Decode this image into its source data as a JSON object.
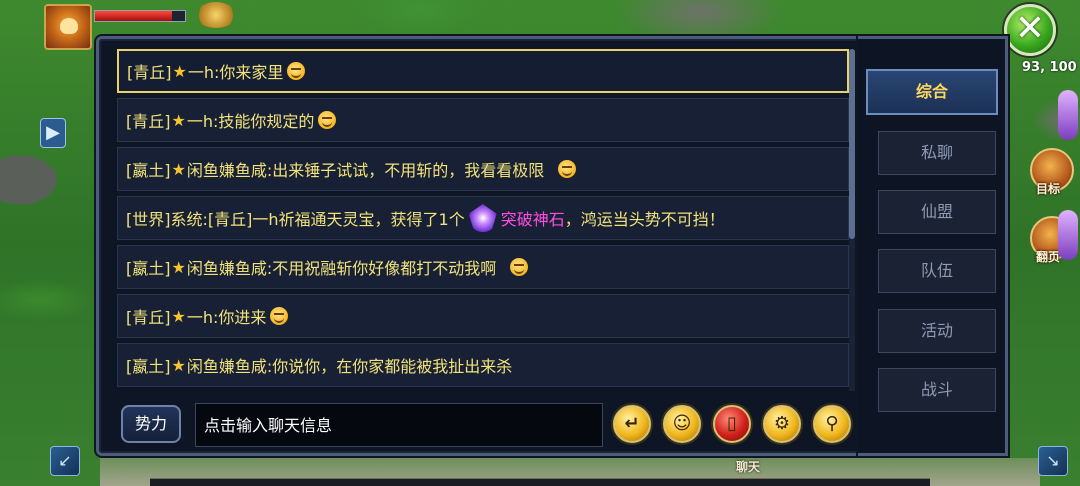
{
  "hud": {
    "hp_fraction": 0.85,
    "coordinates_text": "93, 100",
    "target_label": "目标",
    "flip_label": "翻页",
    "scene_label": "聊天"
  },
  "chat": {
    "messages": [
      {
        "channel": "[青丘]",
        "star": "★",
        "sender": "一h",
        "text": ":你来家里",
        "emoji": true,
        "selected": true
      },
      {
        "channel": "[青丘]",
        "star": "★",
        "sender": "一h",
        "text": ":技能你规定的",
        "emoji": true,
        "selected": false
      },
      {
        "channel": "[嬴土]",
        "star": "★",
        "sender": "闲鱼嫌鱼咸",
        "text": ":出来锤子试试，不用斩的，我看看极限",
        "emoji": true,
        "selected": false
      },
      {
        "channel": "[世界]",
        "star": "",
        "sender": "系统",
        "text": ":[青丘]一h祈福通天灵宝，获得了1个",
        "item": "突破神石",
        "text_after": "，鸿运当头势不可挡！",
        "emoji": false,
        "selected": false
      },
      {
        "channel": "[嬴土]",
        "star": "★",
        "sender": "闲鱼嫌鱼咸",
        "text": ":不用祝融斩你好像都打不动我啊",
        "emoji": true,
        "selected": false
      },
      {
        "channel": "[青丘]",
        "star": "★",
        "sender": "一h",
        "text": ":你进来",
        "emoji": true,
        "selected": false
      },
      {
        "channel": "[嬴土]",
        "star": "★",
        "sender": "闲鱼嫌鱼咸",
        "text": ":你说你，在你家都能被我扯出来杀",
        "emoji": false,
        "selected": false
      }
    ],
    "faction_button": "势力",
    "input_placeholder": "点击输入聊天信息",
    "toolbar": {
      "return_icon": "return-arrow-icon",
      "emoji_icon": "smiley-icon",
      "redpacket_icon": "red-envelope-icon",
      "settings_icon": "gear-icon",
      "location_icon": "location-pin-icon"
    }
  },
  "tabs": [
    {
      "label": "综合",
      "active": true
    },
    {
      "label": "私聊",
      "active": false
    },
    {
      "label": "仙盟",
      "active": false
    },
    {
      "label": "队伍",
      "active": false
    },
    {
      "label": "活动",
      "active": false
    },
    {
      "label": "战斗",
      "active": false
    }
  ],
  "colors": {
    "accent_gold": "#ffd75a",
    "message_text": "#f2e27a",
    "item_highlight": "#ff4fe3",
    "panel_bg": "#0e1626"
  }
}
